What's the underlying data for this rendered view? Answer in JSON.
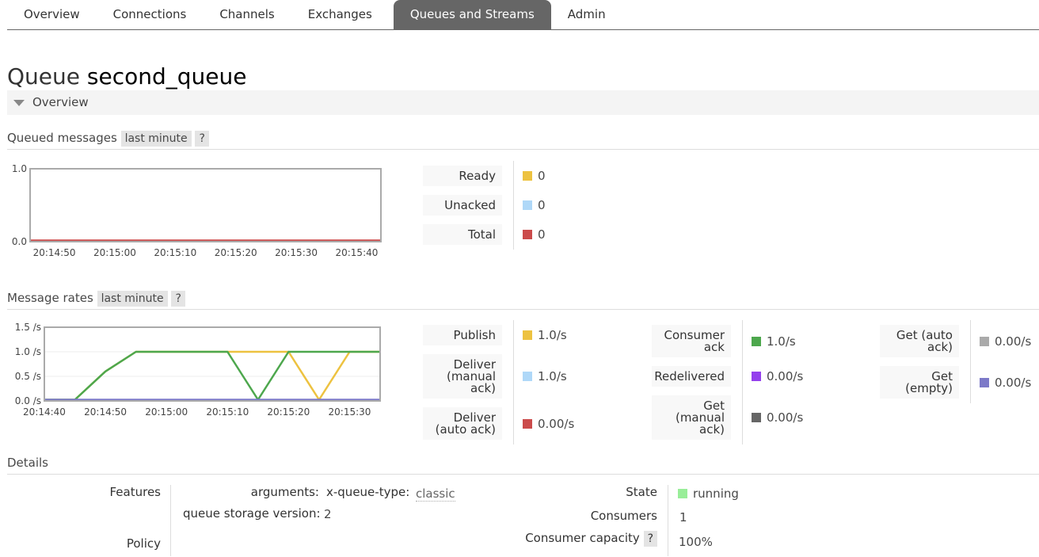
{
  "nav": {
    "tabs": [
      "Overview",
      "Connections",
      "Channels",
      "Exchanges",
      "Queues and Streams",
      "Admin"
    ],
    "active": "Queues and Streams"
  },
  "page": {
    "title_prefix": "Queue",
    "queue_name": "second_queue",
    "section": "Overview"
  },
  "queued": {
    "title": "Queued messages",
    "range": "last minute",
    "help": "?",
    "legend": [
      {
        "label": "Ready",
        "value": "0",
        "color": "#edc240"
      },
      {
        "label": "Unacked",
        "value": "0",
        "color": "#afd8f8"
      },
      {
        "label": "Total",
        "value": "0",
        "color": "#cb4b4b"
      }
    ]
  },
  "rates": {
    "title": "Message rates",
    "range": "last minute",
    "help": "?",
    "col1": [
      {
        "label": "Publish",
        "value": "1.0/s",
        "color": "#edc240"
      },
      {
        "label": "Deliver (manual ack)",
        "value": "1.0/s",
        "color": "#afd8f8"
      },
      {
        "label": "Deliver (auto ack)",
        "value": "0.00/s",
        "color": "#cb4b4b"
      }
    ],
    "col2": [
      {
        "label": "Consumer ack",
        "value": "1.0/s",
        "color": "#4da74d"
      },
      {
        "label": "Redelivered",
        "value": "0.00/s",
        "color": "#9440ed"
      },
      {
        "label": "Get (manual ack)",
        "value": "0.00/s",
        "color": "#666666"
      }
    ],
    "col3": [
      {
        "label": "Get (auto ack)",
        "value": "0.00/s",
        "color": "#aaaaaa"
      },
      {
        "label": "Get (empty)",
        "value": "0.00/s",
        "color": "#7c79c8"
      }
    ]
  },
  "chart_data": [
    {
      "type": "line",
      "yticks": [
        "0.0",
        "1.0"
      ],
      "ylim": [
        0,
        1
      ],
      "xticks": [
        "20:14:50",
        "20:15:00",
        "20:15:10",
        "20:15:20",
        "20:15:30",
        "20:15:40"
      ],
      "x": [
        "20:14:46",
        "20:15:44"
      ],
      "series": [
        {
          "name": "Total",
          "color": "#cb4b4b",
          "values": [
            0,
            0
          ]
        }
      ]
    },
    {
      "type": "line",
      "yticks": [
        "0.0 /s",
        "0.5 /s",
        "1.0 /s",
        "1.5 /s"
      ],
      "ylim": [
        0,
        1.5
      ],
      "xticks": [
        "20:14:40",
        "20:14:50",
        "20:15:00",
        "20:15:10",
        "20:15:20",
        "20:15:30"
      ],
      "x": [
        "20:14:40",
        "20:14:45",
        "20:14:50",
        "20:14:55",
        "20:15:00",
        "20:15:05",
        "20:15:10",
        "20:15:15",
        "20:15:20",
        "20:15:25",
        "20:15:30",
        "20:15:35"
      ],
      "series": [
        {
          "name": "Publish",
          "color": "#edc240",
          "values": [
            0,
            0,
            0.6,
            1,
            1,
            1,
            1,
            1,
            1,
            0,
            1,
            1
          ]
        },
        {
          "name": "Consumer ack",
          "color": "#4da74d",
          "values": [
            0,
            0,
            0.6,
            1,
            1,
            1,
            1,
            0,
            1,
            1,
            1,
            1
          ]
        },
        {
          "name": "Get (empty)",
          "color": "#7c79c8",
          "values": [
            0,
            0,
            0,
            0,
            0,
            0,
            0,
            0,
            0,
            0,
            0,
            0
          ]
        }
      ]
    }
  ],
  "details": {
    "title": "Details",
    "features_label": "Features",
    "arguments_label": "arguments:",
    "arg_key": "x-queue-type:",
    "arg_value": "classic",
    "storage_label": "queue storage version:",
    "storage_value": "2",
    "policy_label": "Policy",
    "state_label": "State",
    "state_value": "running",
    "state_color": "#99ee99",
    "consumers_label": "Consumers",
    "consumers_value": "1",
    "capacity_label": "Consumer capacity",
    "capacity_help": "?",
    "capacity_value": "100%"
  }
}
